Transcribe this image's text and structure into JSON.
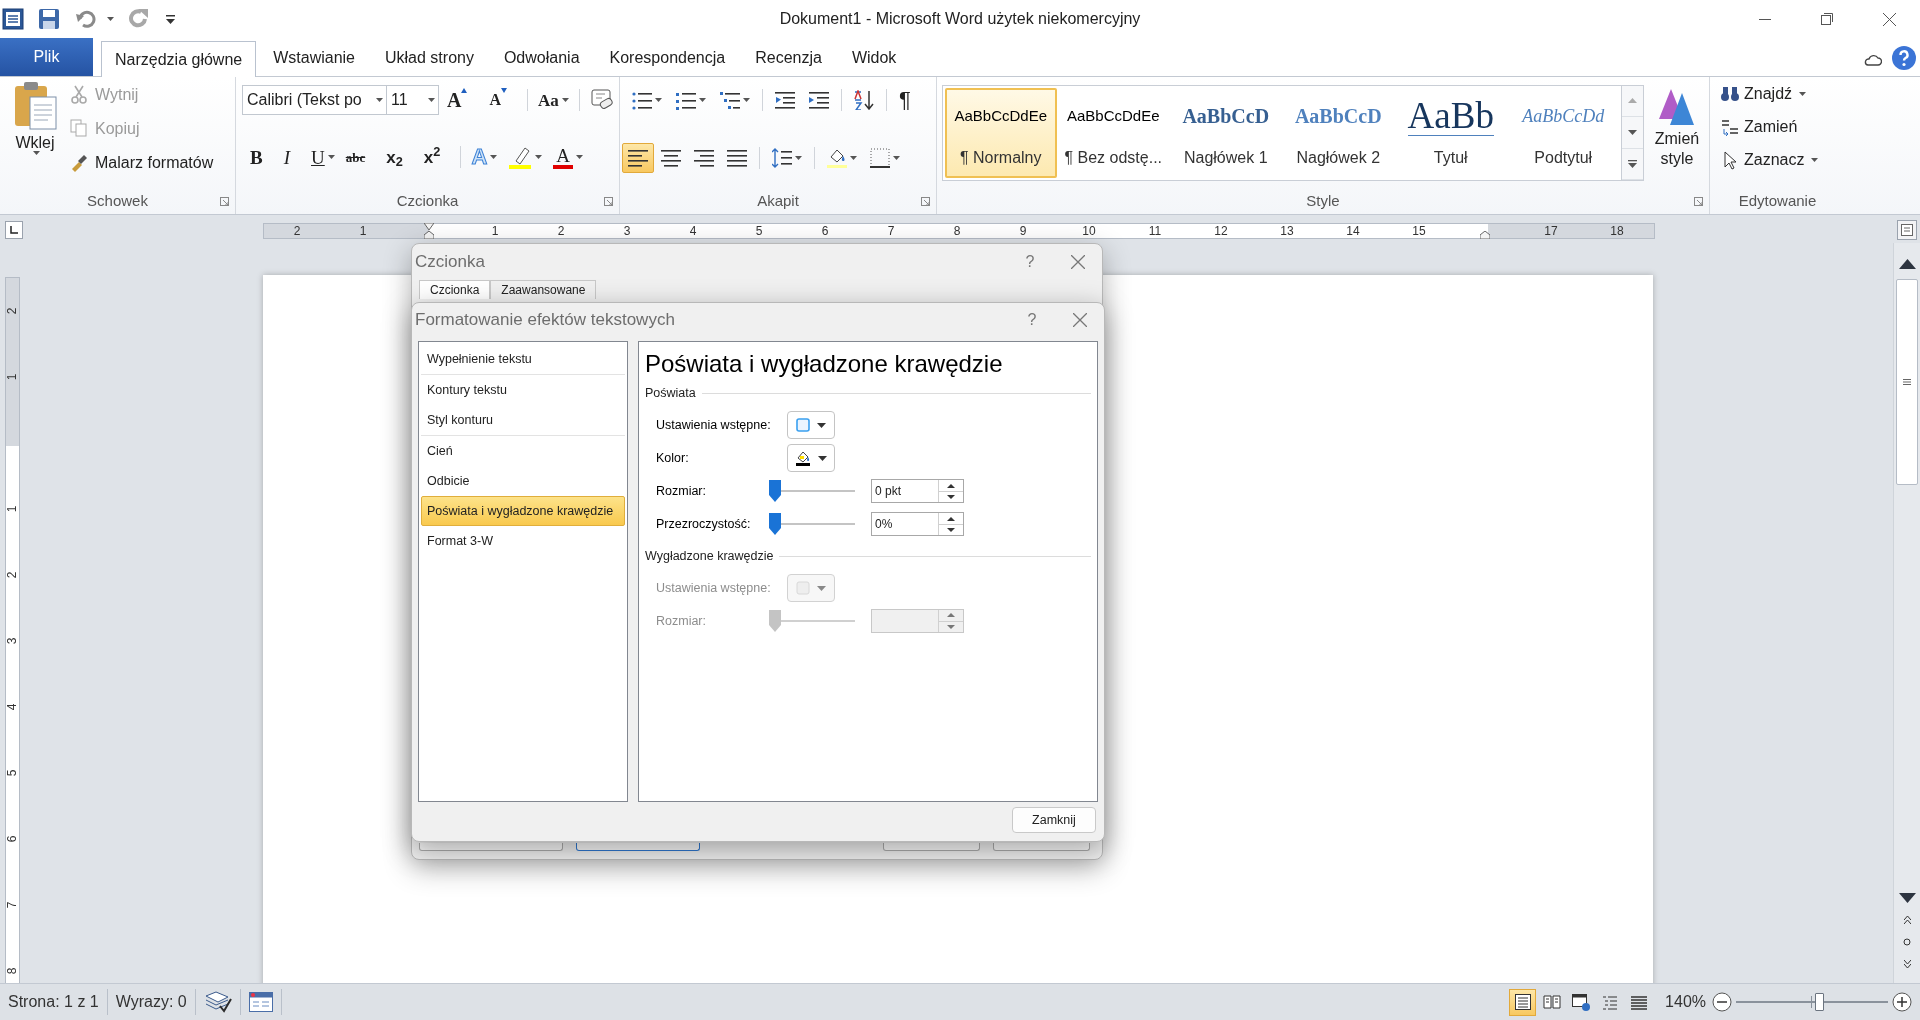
{
  "window": {
    "title": "Dokument1 - Microsoft Word użytek niekomercyjny"
  },
  "ribbon_tabs": [
    {
      "label": "Plik",
      "kind": "file",
      "selected": false
    },
    {
      "label": "Narzędzia główne",
      "kind": "tab",
      "selected": true
    },
    {
      "label": "Wstawianie",
      "kind": "tab",
      "selected": false
    },
    {
      "label": "Układ strony",
      "kind": "tab",
      "selected": false
    },
    {
      "label": "Odwołania",
      "kind": "tab",
      "selected": false
    },
    {
      "label": "Korespondencja",
      "kind": "tab",
      "selected": false
    },
    {
      "label": "Recenzja",
      "kind": "tab",
      "selected": false
    },
    {
      "label": "Widok",
      "kind": "tab",
      "selected": false
    }
  ],
  "clipboard": {
    "title": "Schowek",
    "paste": "Wklej",
    "items": [
      {
        "label": "Wytnij",
        "kind": "cut",
        "disabled": true
      },
      {
        "label": "Kopiuj",
        "kind": "copy",
        "disabled": true
      },
      {
        "label": "Malarz formatów",
        "kind": "painter",
        "disabled": false
      }
    ]
  },
  "font": {
    "title": "Czcionka",
    "font_name": "Calibri (Tekst po",
    "font_size": "11",
    "row_1": [
      {
        "glyph": "A",
        "kind": "grow",
        "menu": false
      },
      {
        "glyph": "A",
        "kind": "shrink",
        "menu": false
      },
      {
        "glyph": "Aa",
        "kind": "case",
        "menu": true
      },
      {
        "kind": "clear",
        "menu": false
      }
    ],
    "row_2": [
      {
        "glyph": "B",
        "kind": "bold",
        "menu": false
      },
      {
        "glyph": "I",
        "kind": "italic",
        "menu": false
      },
      {
        "glyph": "U",
        "kind": "underline",
        "menu": true
      },
      {
        "glyph": "abc",
        "kind": "strike",
        "menu": false
      },
      {
        "glyph": "x$_{2}$",
        "kind": "sub",
        "menu": false
      },
      {
        "glyph": "x$^{2}$",
        "kind": "sup",
        "menu": false
      },
      {
        "glyph": "A",
        "kind": "effects",
        "menu": true
      },
      {
        "kind": "highlight",
        "menu": true
      },
      {
        "glyph": "A",
        "kind": "color",
        "menu": true
      }
    ]
  },
  "paragraph": {
    "title": "Akapit",
    "row_1": [
      {
        "kind": "bullets",
        "menu": true,
        "selected": false
      },
      {
        "kind": "numbering",
        "menu": true,
        "selected": false
      },
      {
        "kind": "multilevel",
        "menu": true,
        "selected": false
      },
      {
        "kind": "outdent",
        "menu": false,
        "selected": false
      },
      {
        "kind": "indent",
        "menu": false,
        "selected": false
      },
      {
        "kind": "sort",
        "menu": false,
        "selected": false
      },
      {
        "kind": "pilcrow",
        "glyph": "¶",
        "menu": false,
        "selected": false
      }
    ],
    "row_2": [
      {
        "kind": "left",
        "menu": false,
        "selected": true
      },
      {
        "kind": "center",
        "menu": false,
        "selected": false
      },
      {
        "kind": "right",
        "menu": false,
        "selected": false
      },
      {
        "kind": "justify",
        "menu": false,
        "selected": false
      },
      {
        "kind": "spacing",
        "menu": true,
        "selected": false
      },
      {
        "kind": "shading",
        "menu": true,
        "selected": false
      },
      {
        "kind": "borders",
        "menu": true,
        "selected": false
      }
    ]
  },
  "styles": {
    "title": "Style",
    "change_styles": "Zmień style",
    "items": [
      {
        "preview": "AaBbCcDdEe",
        "name": "¶ Normalny",
        "kind": "normal",
        "selected": true
      },
      {
        "preview": "AaBbCcDdEe",
        "name": "¶ Bez odstę...",
        "kind": "normal",
        "selected": false
      },
      {
        "preview": "AaBbCcD",
        "name": "Nagłówek 1",
        "kind": "heading1",
        "selected": false
      },
      {
        "preview": "AaBbCcD",
        "name": "Nagłówek 2",
        "kind": "heading2",
        "selected": false
      },
      {
        "preview": "AaBb",
        "name": "Tytuł",
        "kind": "title",
        "selected": false
      },
      {
        "preview": "AaBbCcDd",
        "name": "Podtytuł",
        "kind": "subtitle",
        "selected": false
      }
    ]
  },
  "editing": {
    "title": "Edytowanie",
    "items": [
      {
        "label": "Znajdź",
        "kind": "find",
        "menu": true
      },
      {
        "label": "Zamień",
        "kind": "replace",
        "menu": false
      },
      {
        "label": "Zaznacz",
        "kind": "select",
        "menu": true
      }
    ]
  },
  "ruler": [
    {
      "kind": "number",
      "label": "2"
    },
    {
      "kind": "number",
      "label": "1"
    },
    {
      "kind": "indent"
    },
    {
      "kind": "number",
      "label": "1"
    },
    {
      "kind": "number",
      "label": "2"
    },
    {
      "kind": "number",
      "label": "3"
    },
    {
      "kind": "number",
      "label": "4"
    },
    {
      "kind": "number",
      "label": "5"
    },
    {
      "kind": "number",
      "label": "6"
    },
    {
      "kind": "number",
      "label": "7"
    },
    {
      "kind": "number",
      "label": "8"
    },
    {
      "kind": "number",
      "label": "9"
    },
    {
      "kind": "number",
      "label": "10"
    },
    {
      "kind": "number",
      "label": "11"
    },
    {
      "kind": "number",
      "label": "12"
    },
    {
      "kind": "number",
      "label": "13"
    },
    {
      "kind": "number",
      "label": "14"
    },
    {
      "kind": "number",
      "label": "15"
    },
    {
      "kind": "margin"
    },
    {
      "kind": "number",
      "label": "17"
    },
    {
      "kind": "number",
      "label": "18"
    }
  ],
  "vertical_ruler": [
    {
      "kind": "number",
      "label": "2"
    },
    {
      "kind": "number",
      "label": "1"
    },
    {
      "kind": "margin"
    },
    {
      "kind": "number",
      "label": "1"
    },
    {
      "kind": "number",
      "label": "2"
    },
    {
      "kind": "number",
      "label": "3"
    },
    {
      "kind": "number",
      "label": "4"
    },
    {
      "kind": "number",
      "label": "5"
    },
    {
      "kind": "number",
      "label": "6"
    },
    {
      "kind": "number",
      "label": "7"
    },
    {
      "kind": "number",
      "label": "8"
    }
  ],
  "font_dialog": {
    "title": "Czcionka",
    "help": "?",
    "tabs": [
      {
        "label": "Czcionka",
        "selected": true
      },
      {
        "label": "Zaawansowane",
        "selected": false
      }
    ]
  },
  "effects_dialog": {
    "title": "Formatowanie efektów tekstowych",
    "help": "?",
    "categories": [
      {
        "items": [
          {
            "label": "Wypełnienie tekstu",
            "selected": false
          }
        ]
      },
      {
        "items": [
          {
            "label": "Kontury tekstu",
            "selected": false
          },
          {
            "label": "Styl konturu",
            "selected": false
          }
        ]
      },
      {
        "items": [
          {
            "label": "Cień",
            "selected": false
          },
          {
            "label": "Odbicie",
            "selected": false
          },
          {
            "label": "Poświata i wygładzone krawędzie",
            "selected": true
          },
          {
            "label": "Format 3-W",
            "selected": false
          }
        ]
      }
    ],
    "heading": "Poświata i wygładzone krawędzie",
    "sections": [
      {
        "title": "Poświata",
        "rows": [
          {
            "kind": "preset",
            "label": "Ustawienia wstępne:",
            "disabled": false
          },
          {
            "kind": "color",
            "label": "Kolor:",
            "disabled": false
          },
          {
            "kind": "slider",
            "label": "Rozmiar:",
            "level": 0,
            "value": "0 pkt",
            "disabled": false
          },
          {
            "kind": "slider",
            "label": "Przezroczystość:",
            "level": 0,
            "value": "0%",
            "disabled": false
          }
        ]
      },
      {
        "title": "Wygładzone krawędzie",
        "rows": [
          {
            "kind": "preset",
            "label": "Ustawienia wstępne:",
            "disabled": true
          },
          {
            "kind": "slider",
            "label": "Rozmiar:",
            "level": 0,
            "disabled": true
          }
        ]
      }
    ],
    "close_button": "Zamknij"
  },
  "status_bar": {
    "page": "Strona: 1 z 1",
    "words": "Wyrazy: 0",
    "views": [
      {
        "kind": "print",
        "selected": true
      },
      {
        "kind": "reading",
        "selected": false
      },
      {
        "kind": "web",
        "selected": false
      },
      {
        "kind": "outline",
        "selected": false
      },
      {
        "kind": "draft",
        "selected": false
      }
    ],
    "zoom": "140%",
    "zoom_slider": {
      "level": 0.55
    }
  }
}
